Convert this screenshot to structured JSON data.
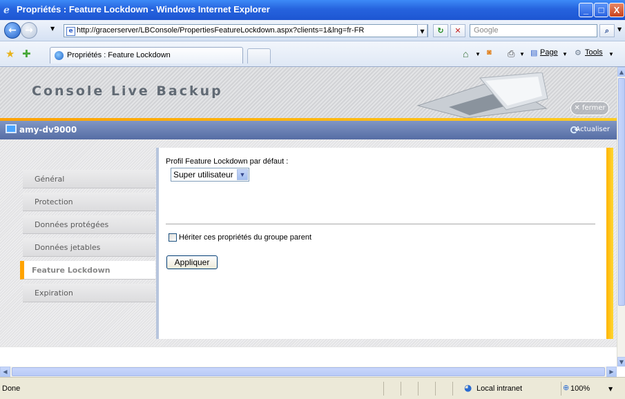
{
  "window": {
    "title": "Propriétés : Feature Lockdown - Windows Internet Explorer",
    "minimize": "_",
    "maximize": "□",
    "close": "X"
  },
  "address_bar": {
    "url": "http://gracerserver/LBConsole/PropertiesFeatureLockdown.aspx?clients=1&lng=fr-FR",
    "search_placeholder": "Google"
  },
  "tabs": [
    {
      "label": "Propriétés : Feature Lockdown"
    }
  ],
  "toolbar": {
    "page_label": "Page",
    "tools_label": "Tools"
  },
  "banner": {
    "title": "Console Live Backup",
    "close_label": "fermer"
  },
  "machine": {
    "name": "amy-dv9000",
    "refresh_label": "Actualiser"
  },
  "nav": {
    "items": [
      {
        "label": "Général"
      },
      {
        "label": "Protection"
      },
      {
        "label": "Données protégées"
      },
      {
        "label": "Données jetables"
      },
      {
        "label": "Feature Lockdown"
      },
      {
        "label": "Expiration"
      }
    ],
    "active_index": 4
  },
  "form": {
    "profile_label": "Profil Feature Lockdown par défaut :",
    "profile_value": "Super utilisateur",
    "inherit_label": "Hériter ces propriétés du groupe parent",
    "inherit_checked": false,
    "apply_label": "Appliquer"
  },
  "status": {
    "text": "Done",
    "zone": "Local intranet",
    "zoom": "100%"
  },
  "colors": {
    "accent_orange": "#ffa300",
    "machine_bar": "#566da4",
    "titlebar": "#2663de"
  }
}
